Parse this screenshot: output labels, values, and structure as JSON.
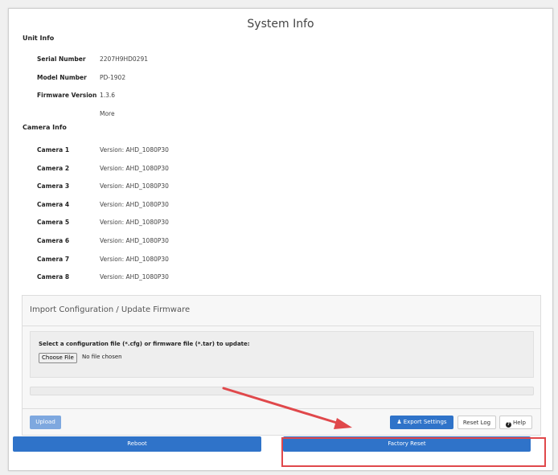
{
  "page": {
    "title": "System Info"
  },
  "unit_info": {
    "heading": "Unit Info",
    "rows": [
      {
        "label": "Serial Number",
        "value": "2207H9HD0291"
      },
      {
        "label": "Model Number",
        "value": "PD-1902"
      },
      {
        "label": "Firmware Version",
        "value": "1.3.6"
      }
    ],
    "more_label": "More"
  },
  "camera_info": {
    "heading": "Camera Info",
    "rows": [
      {
        "label": "Camera 1",
        "value": "Version: AHD_1080P30"
      },
      {
        "label": "Camera 2",
        "value": "Version: AHD_1080P30"
      },
      {
        "label": "Camera 3",
        "value": "Version: AHD_1080P30"
      },
      {
        "label": "Camera 4",
        "value": "Version: AHD_1080P30"
      },
      {
        "label": "Camera 5",
        "value": "Version: AHD_1080P30"
      },
      {
        "label": "Camera 6",
        "value": "Version: AHD_1080P30"
      },
      {
        "label": "Camera 7",
        "value": "Version: AHD_1080P30"
      },
      {
        "label": "Camera 8",
        "value": "Version: AHD_1080P30"
      }
    ]
  },
  "import_panel": {
    "title": "Import Configuration / Update Firmware",
    "file_label": "Select a configuration file (*.cfg) or firmware file (*.tar) to update:",
    "choose_file_label": "Choose File",
    "no_file_text": "No file chosen",
    "upload_label": "Upload",
    "export_label": "Export Settings",
    "reset_log_label": "Reset Log",
    "help_label": "Help",
    "export_icon": "user-icon",
    "help_icon": "question-circle-icon"
  },
  "footer": {
    "reboot_label": "Reboot",
    "factory_reset_label": "Factory Reset"
  },
  "colors": {
    "primary": "#2f73c9",
    "disabled_primary": "#7ea8df",
    "annotation": "#e0484b"
  }
}
